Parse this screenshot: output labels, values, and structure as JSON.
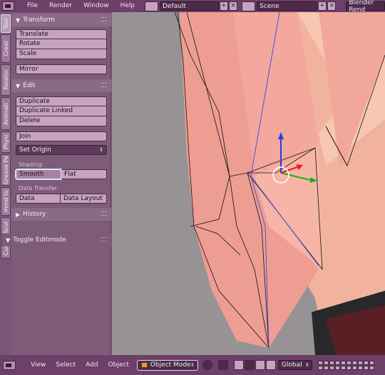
{
  "topbar": {
    "menus": [
      "File",
      "Render",
      "Window",
      "Help"
    ],
    "screen_layout": "Default",
    "scene": "Scene",
    "engine": "Blender Rend"
  },
  "tabs": [
    "Tool",
    "Creat",
    "Relatio",
    "Animati",
    "Physi",
    "Grease Pe",
    "mmd to",
    "Scul",
    "Curv"
  ],
  "toolshelf": {
    "transform": {
      "title": "Transform",
      "buttons": [
        "Translate",
        "Rotate",
        "Scale"
      ],
      "mirror": "Mirror"
    },
    "edit": {
      "title": "Edit",
      "buttons": [
        "Duplicate",
        "Duplicate Linked",
        "Delete"
      ],
      "join": "Join",
      "set_origin": "Set Origin",
      "shading_label": "Shading:",
      "smooth": "Smooth",
      "flat": "Flat",
      "data_transfer_label": "Data Transfer:",
      "data": "Data",
      "data_layout": "Data Layout"
    },
    "history": {
      "title": "History"
    },
    "toggle_editmode": {
      "title": "Toggle Editmode"
    }
  },
  "bottombar": {
    "menus": [
      "View",
      "Select",
      "Add",
      "Object"
    ],
    "mode": "Object Mode",
    "orientation": "Global"
  },
  "colors": {
    "theme_header": "#6d3f69",
    "panel_bg": "#7d5b79",
    "button": "#c7a3c1",
    "viewport_bg": "#979394",
    "mesh_skin": "#f0a09a",
    "axis_x": "#e0201e",
    "axis_y": "#1fb01f",
    "axis_z": "#2040e0"
  }
}
